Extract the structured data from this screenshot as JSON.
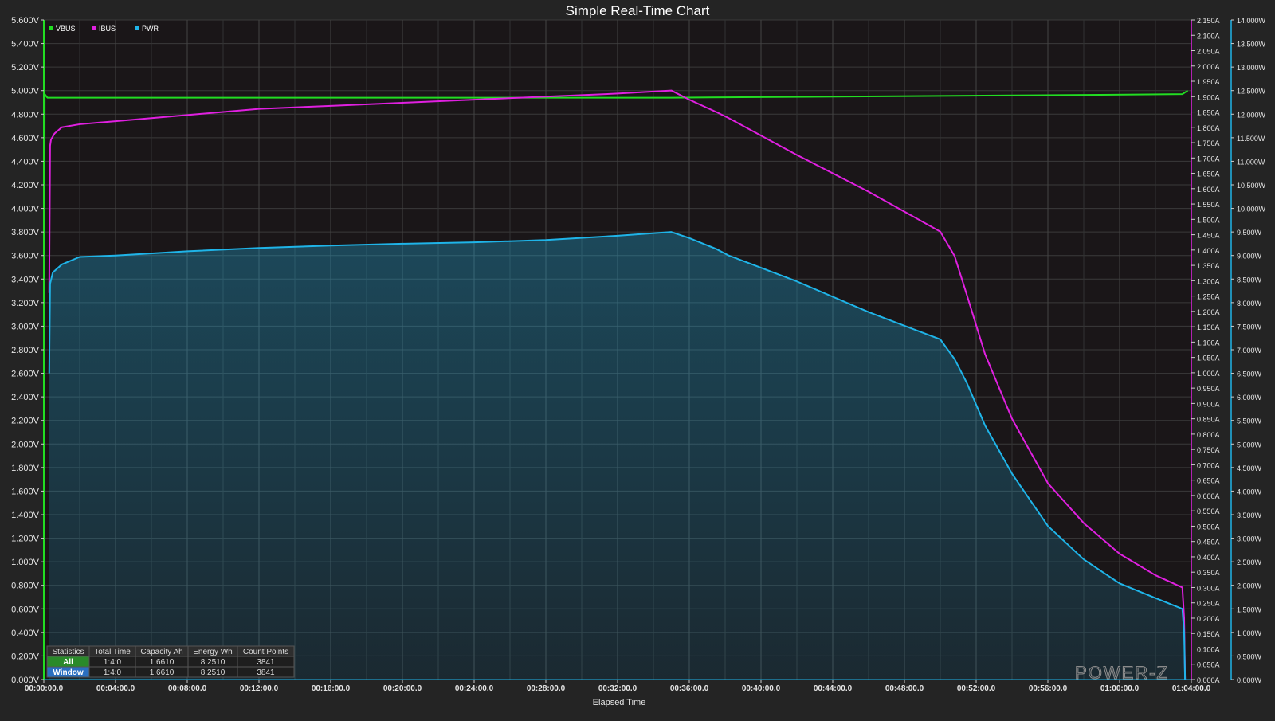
{
  "chart_data": {
    "type": "line",
    "title": "Simple Real-Time Chart",
    "xlabel": "Elapsed Time",
    "x_unit": "minutes",
    "xlim": [
      0,
      64
    ],
    "x_ticks": [
      "00:00:00.0",
      "00:04:00.0",
      "00:08:00.0",
      "00:12:00.0",
      "00:16:00.0",
      "00:20:00.0",
      "00:24:00.0",
      "00:28:00.0",
      "00:32:00.0",
      "00:36:00.0",
      "00:40:00.0",
      "00:44:00.0",
      "00:48:00.0",
      "00:52:00.0",
      "00:56:00.0",
      "01:00:00.0",
      "01:04:00.0"
    ],
    "axes": [
      {
        "id": "volt",
        "side": "left",
        "unit": "V",
        "ylim": [
          0,
          5.6
        ],
        "step": 0.2,
        "decimals": 3
      },
      {
        "id": "amp",
        "side": "right-inner",
        "unit": "A",
        "ylim": [
          0,
          2.15
        ],
        "step": 0.05,
        "decimals": 3
      },
      {
        "id": "watt",
        "side": "right-outer",
        "unit": "W",
        "ylim": [
          0,
          14
        ],
        "step": 0.5,
        "decimals": 3
      }
    ],
    "legend_position": "top-left",
    "grid": true,
    "series": [
      {
        "name": "VBUS",
        "axis": "volt",
        "color": "#22dd22",
        "fill": false,
        "x": [
          0,
          0.05,
          0.2,
          2,
          10,
          20,
          35,
          45,
          55,
          63.5,
          63.8
        ],
        "y": [
          0.0,
          4.97,
          4.94,
          4.94,
          4.94,
          4.94,
          4.94,
          4.95,
          4.96,
          4.97,
          5.0
        ]
      },
      {
        "name": "IBUS",
        "axis": "amp",
        "color": "#e020e0",
        "fill": false,
        "x": [
          0.3,
          0.35,
          0.4,
          0.6,
          1,
          2,
          4,
          8,
          12,
          16,
          20,
          24,
          28,
          32,
          35,
          36,
          37.5,
          38.2,
          42,
          46,
          50,
          50.8,
          51.5,
          52.5,
          54,
          56,
          58,
          60,
          62,
          63.5,
          63.6,
          63.65
        ],
        "y": [
          1.26,
          1.74,
          1.76,
          1.78,
          1.8,
          1.81,
          1.82,
          1.84,
          1.86,
          1.87,
          1.88,
          1.89,
          1.9,
          1.91,
          1.92,
          1.89,
          1.85,
          1.83,
          1.71,
          1.59,
          1.46,
          1.38,
          1.25,
          1.06,
          0.85,
          0.64,
          0.51,
          0.41,
          0.34,
          0.3,
          0.2,
          0.0
        ]
      },
      {
        "name": "PWR",
        "axis": "watt",
        "color": "#1fb4e8",
        "fill": true,
        "x": [
          0.3,
          0.35,
          0.5,
          1,
          2,
          4,
          8,
          12,
          16,
          20,
          24,
          28,
          32,
          35,
          36,
          37.5,
          38.2,
          42,
          46,
          50,
          50.8,
          51.5,
          52.5,
          54,
          56,
          58,
          60,
          62,
          63.5,
          63.6,
          63.65
        ],
        "y": [
          6.5,
          8.4,
          8.64,
          8.81,
          8.97,
          9.0,
          9.09,
          9.16,
          9.21,
          9.25,
          9.28,
          9.33,
          9.42,
          9.5,
          9.37,
          9.14,
          9.0,
          8.45,
          7.8,
          7.22,
          6.8,
          6.28,
          5.39,
          4.37,
          3.26,
          2.55,
          2.04,
          1.73,
          1.5,
          0.99,
          0.0
        ]
      }
    ],
    "statistics_table": {
      "headers": [
        "Statistics",
        "Total Time",
        "Capacity Ah",
        "Energy Wh",
        "Count Points"
      ],
      "rows": [
        {
          "label": "All",
          "label_color": "#2a8a2a",
          "values": [
            "1:4:0",
            "1.6610",
            "8.2510",
            "3841"
          ]
        },
        {
          "label": "Window",
          "label_color": "#2a6fc0",
          "values": [
            "1:4:0",
            "1.6610",
            "8.2510",
            "3841"
          ]
        }
      ]
    },
    "watermark": "POWER-Z"
  },
  "colors": {
    "background": "#242424",
    "plot_background": "#1a1618",
    "grid": "#3a3a3a",
    "text": "#ffffff",
    "tick_text": "#e6e6e6"
  }
}
